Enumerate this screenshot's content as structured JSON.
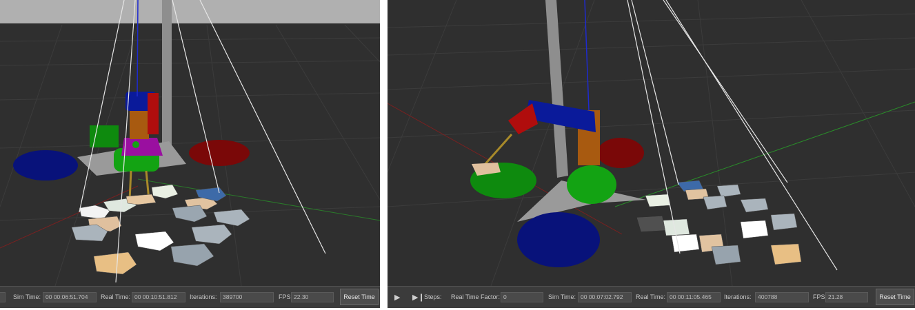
{
  "left_view": {
    "toolbar": {
      "sim_time_label": "Sim Time:",
      "sim_time_value": "00 00:06:51.704",
      "real_time_label": "Real Time:",
      "real_time_value": "00 00:10:51.812",
      "iterations_label": "Iterations:",
      "iterations_value": "389700",
      "fps_label": "FPS:",
      "fps_value": "22.30",
      "reset_label": "Reset Time"
    }
  },
  "right_view": {
    "toolbar": {
      "play_icon": "play-icon",
      "step_icon": "step-forward-icon",
      "steps_label": "Steps:",
      "rtf_label": "Real Time Factor:",
      "rtf_value": "0",
      "sim_time_label": "Sim Time:",
      "sim_time_value": "00 00:07:02.792",
      "real_time_label": "Real Time:",
      "real_time_value": "00 00:11:05.465",
      "iterations_label": "Iterations:",
      "iterations_value": "400788",
      "fps_label": "FPS:",
      "fps_value": "21.28",
      "reset_label": "Reset Time"
    }
  },
  "colors": {
    "background": "#2e2e2e",
    "toolbar": "#3b3b3b",
    "arm_blue": "#0a1a8a",
    "arm_orange": "#b45a10",
    "gripper_green": "#1a9a1a",
    "bin_red": "#8a0a0a",
    "bin_green": "#0e8a0e",
    "bin_blue": "#08127a",
    "base_grey": "#9a9a9a"
  }
}
